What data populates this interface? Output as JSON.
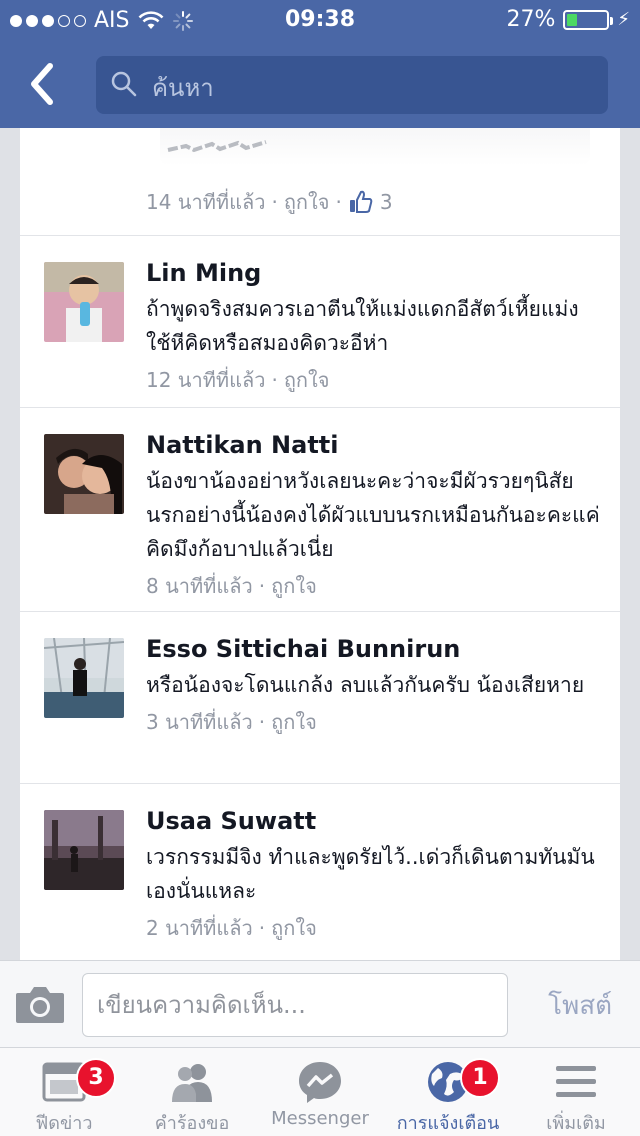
{
  "status_bar": {
    "carrier": "AIS",
    "time": "09:38",
    "battery_percent": "27%",
    "battery_level": 0.27
  },
  "header": {
    "search_placeholder": "ค้นหา"
  },
  "partial_comment": {
    "time": "14 นาทีที่แล้ว",
    "sep1": "·",
    "like_label": "ถูกใจ",
    "sep2": "·",
    "like_count": "3"
  },
  "comments": [
    {
      "name": "Lin Ming",
      "text": "ถ้าพูดจริงสมควรเอาตีนให้แม่งแดกอีสัตว์เหี้ยแม่งใช้หีคิดหรือสมองคิดวะอีห่า",
      "time": "12 นาทีที่แล้ว",
      "sep": "·",
      "like_label": "ถูกใจ"
    },
    {
      "name": "Nattikan Natti",
      "text": "น้องขาน้องอย่าหวังเลยนะคะว่าจะมีผัวรวยๆนิสัยนรกอย่างนี้น้องคงได้ผัวแบบนรกเหมือนกันอะคะแค่คิดมึงก้อบาปแล้วเนี่ย",
      "time": "8 นาทีที่แล้ว",
      "sep": "·",
      "like_label": "ถูกใจ"
    },
    {
      "name": "Esso Sittichai Bunnirun",
      "text": "หรือน้องจะโดนแกล้ง ลบแล้วกันครับ น้องเสียหาย",
      "time": "3 นาทีที่แล้ว",
      "sep": "·",
      "like_label": "ถูกใจ"
    },
    {
      "name": "Usaa Suwatt",
      "text": "เวรกรรมมีจิง ทำและพูดรัยไว้..เด่วก็เดินตามทันมันเองนั่นแหละ",
      "time": "2 นาทีที่แล้ว",
      "sep": "·",
      "like_label": "ถูกใจ"
    }
  ],
  "composer": {
    "placeholder": "เขียนความคิดเห็น...",
    "post_label": "โพสต์"
  },
  "tabs": [
    {
      "label": "ฟีดข่าว",
      "badge": "3",
      "icon": "news-feed-icon"
    },
    {
      "label": "คำร้องขอ",
      "badge": "",
      "icon": "friend-requests-icon"
    },
    {
      "label": "Messenger",
      "badge": "",
      "icon": "messenger-icon"
    },
    {
      "label": "การแจ้งเตือน",
      "badge": "1",
      "icon": "globe-icon"
    },
    {
      "label": "เพิ่มเติม",
      "badge": "",
      "icon": "menu-icon"
    }
  ],
  "colors": {
    "brand": "#4a67a6",
    "badge": "#e8122d",
    "battery": "#4cd964"
  }
}
